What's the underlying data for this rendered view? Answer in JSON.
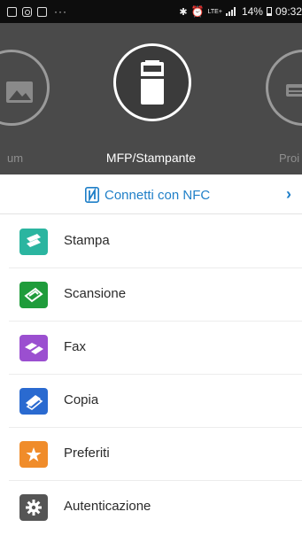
{
  "status_bar": {
    "battery": "14%",
    "time": "09:32",
    "lte": "LTE+"
  },
  "carousel": {
    "left_label": "um",
    "center_label": "MFP/Stampante",
    "right_label": "Proi"
  },
  "nfc": {
    "label": "Connetti con NFC",
    "chevron": "›"
  },
  "menu": {
    "items": [
      {
        "label": "Stampa",
        "icon": "print-icon",
        "color": "#2bb5a0"
      },
      {
        "label": "Scansione",
        "icon": "scan-icon",
        "color": "#1f9c3b"
      },
      {
        "label": "Fax",
        "icon": "fax-icon",
        "color": "#9b4fd0"
      },
      {
        "label": "Copia",
        "icon": "copy-icon",
        "color": "#2a6ad0"
      },
      {
        "label": "Preferiti",
        "icon": "star-icon",
        "color": "#f08c2a"
      },
      {
        "label": "Autenticazione",
        "icon": "gear-icon",
        "color": "#555555"
      }
    ]
  },
  "colors": {
    "header_bg": "#4a4a4a",
    "accent_blue": "#1f7fc8"
  }
}
